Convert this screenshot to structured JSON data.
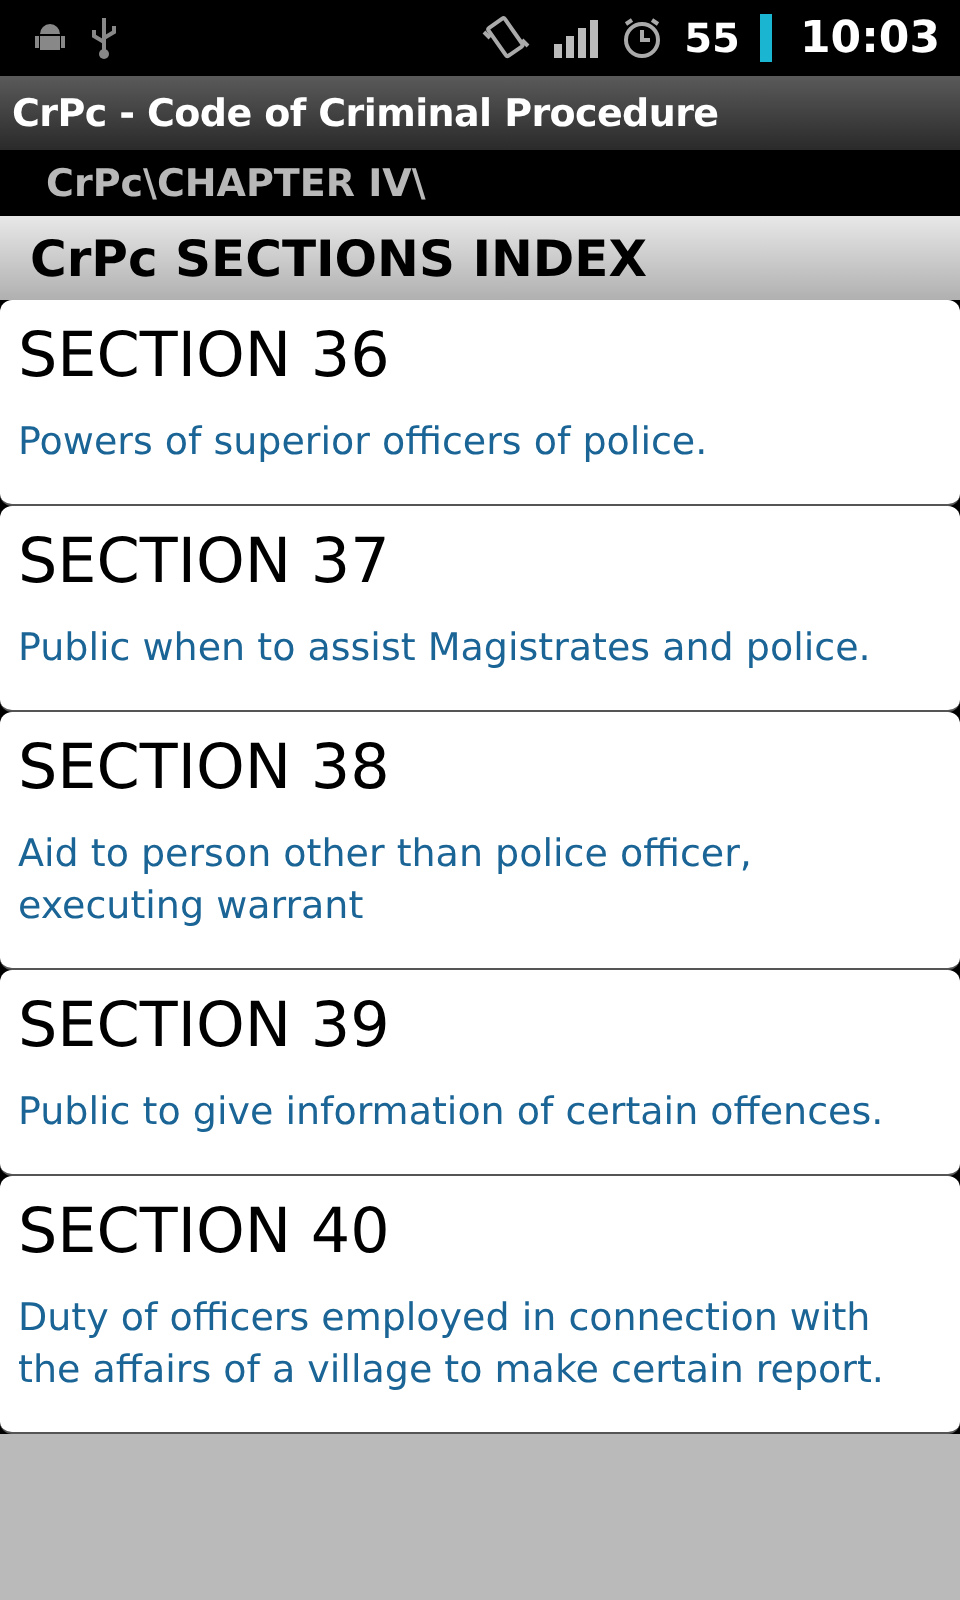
{
  "status_bar": {
    "battery": "55",
    "time": "10:03"
  },
  "window": {
    "title": "CrPc - Code of Criminal Procedure"
  },
  "breadcrumb": "CrPc\\CHAPTER IV\\",
  "list_header": "CrPc SECTIONS INDEX",
  "sections": [
    {
      "title": "SECTION 36",
      "description": "Powers of superior officers of police."
    },
    {
      "title": "SECTION 37",
      "description": "Public when to assist Magistrates and police."
    },
    {
      "title": "SECTION 38",
      "description": "Aid to person other than police officer, executing warrant"
    },
    {
      "title": "SECTION 39",
      "description": "Public to give information of certain offences."
    },
    {
      "title": "SECTION 40",
      "description": "Duty of officers employed in connection with the affairs of a village to make certain report."
    }
  ]
}
